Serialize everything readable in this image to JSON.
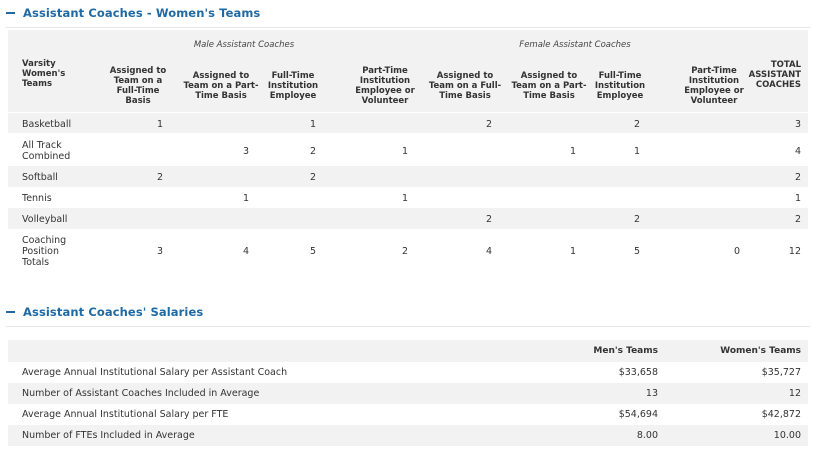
{
  "coaches": {
    "title": "Assistant Coaches - Women's Teams",
    "group_male": "Male Assistant Coaches",
    "group_female": "Female Assistant Coaches",
    "col_team": [
      "Varsity",
      "Women's",
      "Teams"
    ],
    "col_m_ft_team": [
      "Assigned to",
      "Team on a",
      "Full-Time",
      "Basis"
    ],
    "col_m_pt_team": [
      "Assigned to",
      "Team on a Part-",
      "Time Basis"
    ],
    "col_m_ft_inst": [
      "Full-Time",
      "Institution",
      "Employee"
    ],
    "col_m_pt_inst": [
      "Part-Time",
      "Institution",
      "Employee or",
      "Volunteer"
    ],
    "col_f_ft_team": [
      "Assigned to",
      "Team on a Full-",
      "Time Basis"
    ],
    "col_f_pt_team": [
      "Assigned to",
      "Team on a Part-",
      "Time Basis"
    ],
    "col_f_ft_inst": [
      "Full-Time",
      "Institution",
      "Employee"
    ],
    "col_f_pt_inst": [
      "Part-Time",
      "Institution",
      "Employee or",
      "Volunteer"
    ],
    "col_total": [
      "TOTAL",
      "ASSISTANT",
      "COACHES"
    ],
    "rows": [
      {
        "label": [
          "Basketball"
        ],
        "values": [
          "1",
          "",
          "1",
          "",
          "2",
          "",
          "2",
          "",
          "3"
        ]
      },
      {
        "label": [
          "All Track",
          "Combined"
        ],
        "values": [
          "",
          "3",
          "2",
          "1",
          "",
          "1",
          "1",
          "",
          "4"
        ]
      },
      {
        "label": [
          "Softball"
        ],
        "values": [
          "2",
          "",
          "2",
          "",
          "",
          "",
          "",
          "",
          "2"
        ]
      },
      {
        "label": [
          "Tennis"
        ],
        "values": [
          "",
          "1",
          "",
          "1",
          "",
          "",
          "",
          "",
          "1"
        ]
      },
      {
        "label": [
          "Volleyball"
        ],
        "values": [
          "",
          "",
          "",
          "",
          "2",
          "",
          "2",
          "",
          "2"
        ]
      },
      {
        "label": [
          "Coaching",
          "Position",
          "Totals"
        ],
        "values": [
          "3",
          "4",
          "5",
          "2",
          "4",
          "1",
          "5",
          "0",
          "12"
        ]
      }
    ]
  },
  "salaries": {
    "title": "Assistant Coaches' Salaries",
    "col_men": "Men's Teams",
    "col_women": "Women's Teams",
    "rows": [
      {
        "label": "Average Annual Institutional Salary per Assistant Coach",
        "men": "$33,658",
        "women": "$35,727"
      },
      {
        "label": "Number of Assistant Coaches Included in Average",
        "men": "13",
        "women": "12"
      },
      {
        "label": "Average Annual Institutional Salary per FTE",
        "men": "$54,694",
        "women": "$42,872"
      },
      {
        "label": "Number of FTEs Included in Average",
        "men": "8.00",
        "women": "10.00"
      }
    ]
  }
}
